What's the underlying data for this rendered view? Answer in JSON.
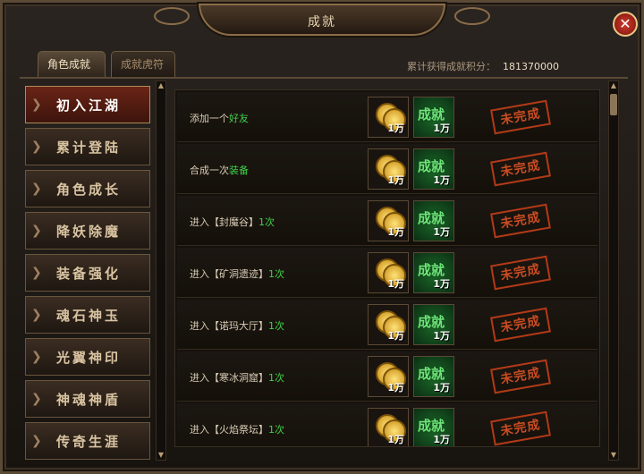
{
  "window": {
    "title": "成就",
    "close_label": "✕"
  },
  "tabs": [
    {
      "label": "角色成就",
      "active": true
    },
    {
      "label": "成就虎符",
      "active": false
    }
  ],
  "score": {
    "label": "累计获得成就积分：",
    "value": "181370000"
  },
  "sidebar": {
    "items": [
      {
        "label": "初入江湖",
        "active": true
      },
      {
        "label": "累计登陆",
        "active": false
      },
      {
        "label": "角色成长",
        "active": false
      },
      {
        "label": "降妖除魔",
        "active": false
      },
      {
        "label": "装备强化",
        "active": false
      },
      {
        "label": "魂石神玉",
        "active": false
      },
      {
        "label": "光翼神印",
        "active": false
      },
      {
        "label": "神魂神盾",
        "active": false
      },
      {
        "label": "传奇生涯",
        "active": false
      }
    ]
  },
  "achievements": [
    {
      "prefix": "添加一个",
      "highlight": "好友",
      "suffix": "",
      "gold": "1万",
      "points": "1万",
      "status": "未完成"
    },
    {
      "prefix": "合成一次",
      "highlight": "装备",
      "suffix": "",
      "gold": "1万",
      "points": "1万",
      "status": "未完成"
    },
    {
      "prefix": "进入【封魔谷】",
      "highlight": "1次",
      "suffix": "",
      "gold": "1万",
      "points": "1万",
      "status": "未完成"
    },
    {
      "prefix": "进入【矿洞遗迹】",
      "highlight": "1次",
      "suffix": "",
      "gold": "1万",
      "points": "1万",
      "status": "未完成"
    },
    {
      "prefix": "进入【诺玛大厅】",
      "highlight": "1次",
      "suffix": "",
      "gold": "1万",
      "points": "1万",
      "status": "未完成"
    },
    {
      "prefix": "进入【寒冰洞窟】",
      "highlight": "1次",
      "suffix": "",
      "gold": "1万",
      "points": "1万",
      "status": "未完成"
    },
    {
      "prefix": "进入【火焰祭坛】",
      "highlight": "1次",
      "suffix": "",
      "gold": "1万",
      "points": "1万",
      "status": "未完成"
    }
  ],
  "reward_icon_label": "成就",
  "scroll_up": "▲",
  "scroll_down": "▼",
  "sidebar_chevron": "❯",
  "colors": {
    "accent": "#3fd24a",
    "stamp": "#c84c22",
    "active_tab": "#6a2416"
  }
}
